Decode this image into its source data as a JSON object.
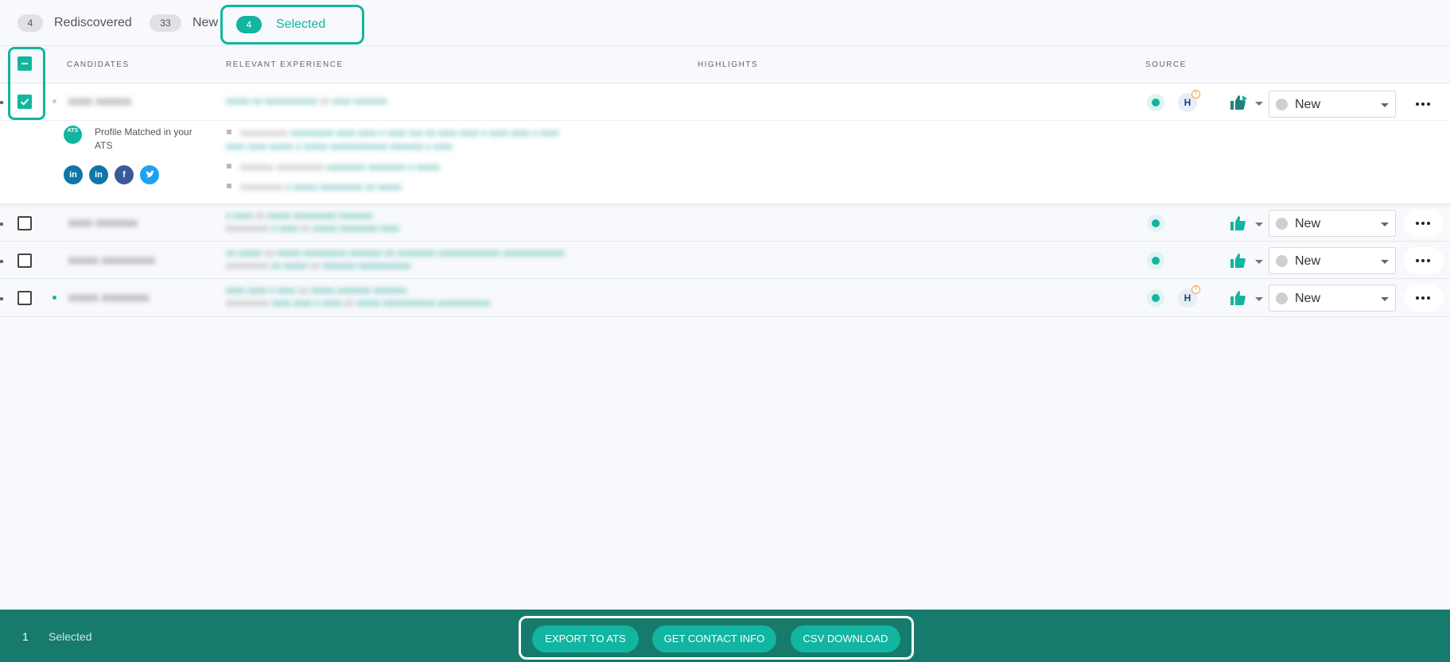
{
  "tabs": [
    {
      "count": "4",
      "label": "Rediscovered"
    },
    {
      "count": "33",
      "label": "New"
    },
    {
      "count": "4",
      "label": "Selected"
    }
  ],
  "table": {
    "headers": {
      "candidates": "CANDIDATES",
      "experience": "RELEVANT EXPERIENCE",
      "highlights": "HIGHLIGHTS",
      "source": "SOURCE"
    }
  },
  "rows": [
    {
      "checked": true,
      "status": "New",
      "source_icons": [
        "ats-source-icon",
        "hiring-source-icon"
      ],
      "details": {
        "ats_badge": "ATS",
        "ats_text": "Profile Matched in your ATS",
        "social_icons": [
          "linkedin-icon",
          "linkedin-icon",
          "facebook-icon",
          "twitter-icon"
        ]
      }
    },
    {
      "checked": false,
      "status": "New",
      "source_icons": [
        "ats-source-icon"
      ]
    },
    {
      "checked": false,
      "status": "New",
      "source_icons": [
        "ats-source-icon"
      ]
    },
    {
      "checked": false,
      "status": "New",
      "source_icons": [
        "ats-source-icon",
        "hiring-source-icon"
      ]
    }
  ],
  "bottom_bar": {
    "count": "1",
    "label": "Selected",
    "actions": [
      "EXPORT TO ATS",
      "GET CONTACT INFO",
      "CSV DOWNLOAD"
    ]
  },
  "colors": {
    "accent": "#12b59f",
    "bottom_bar": "#167b6d",
    "link_text": "#12a08f"
  }
}
